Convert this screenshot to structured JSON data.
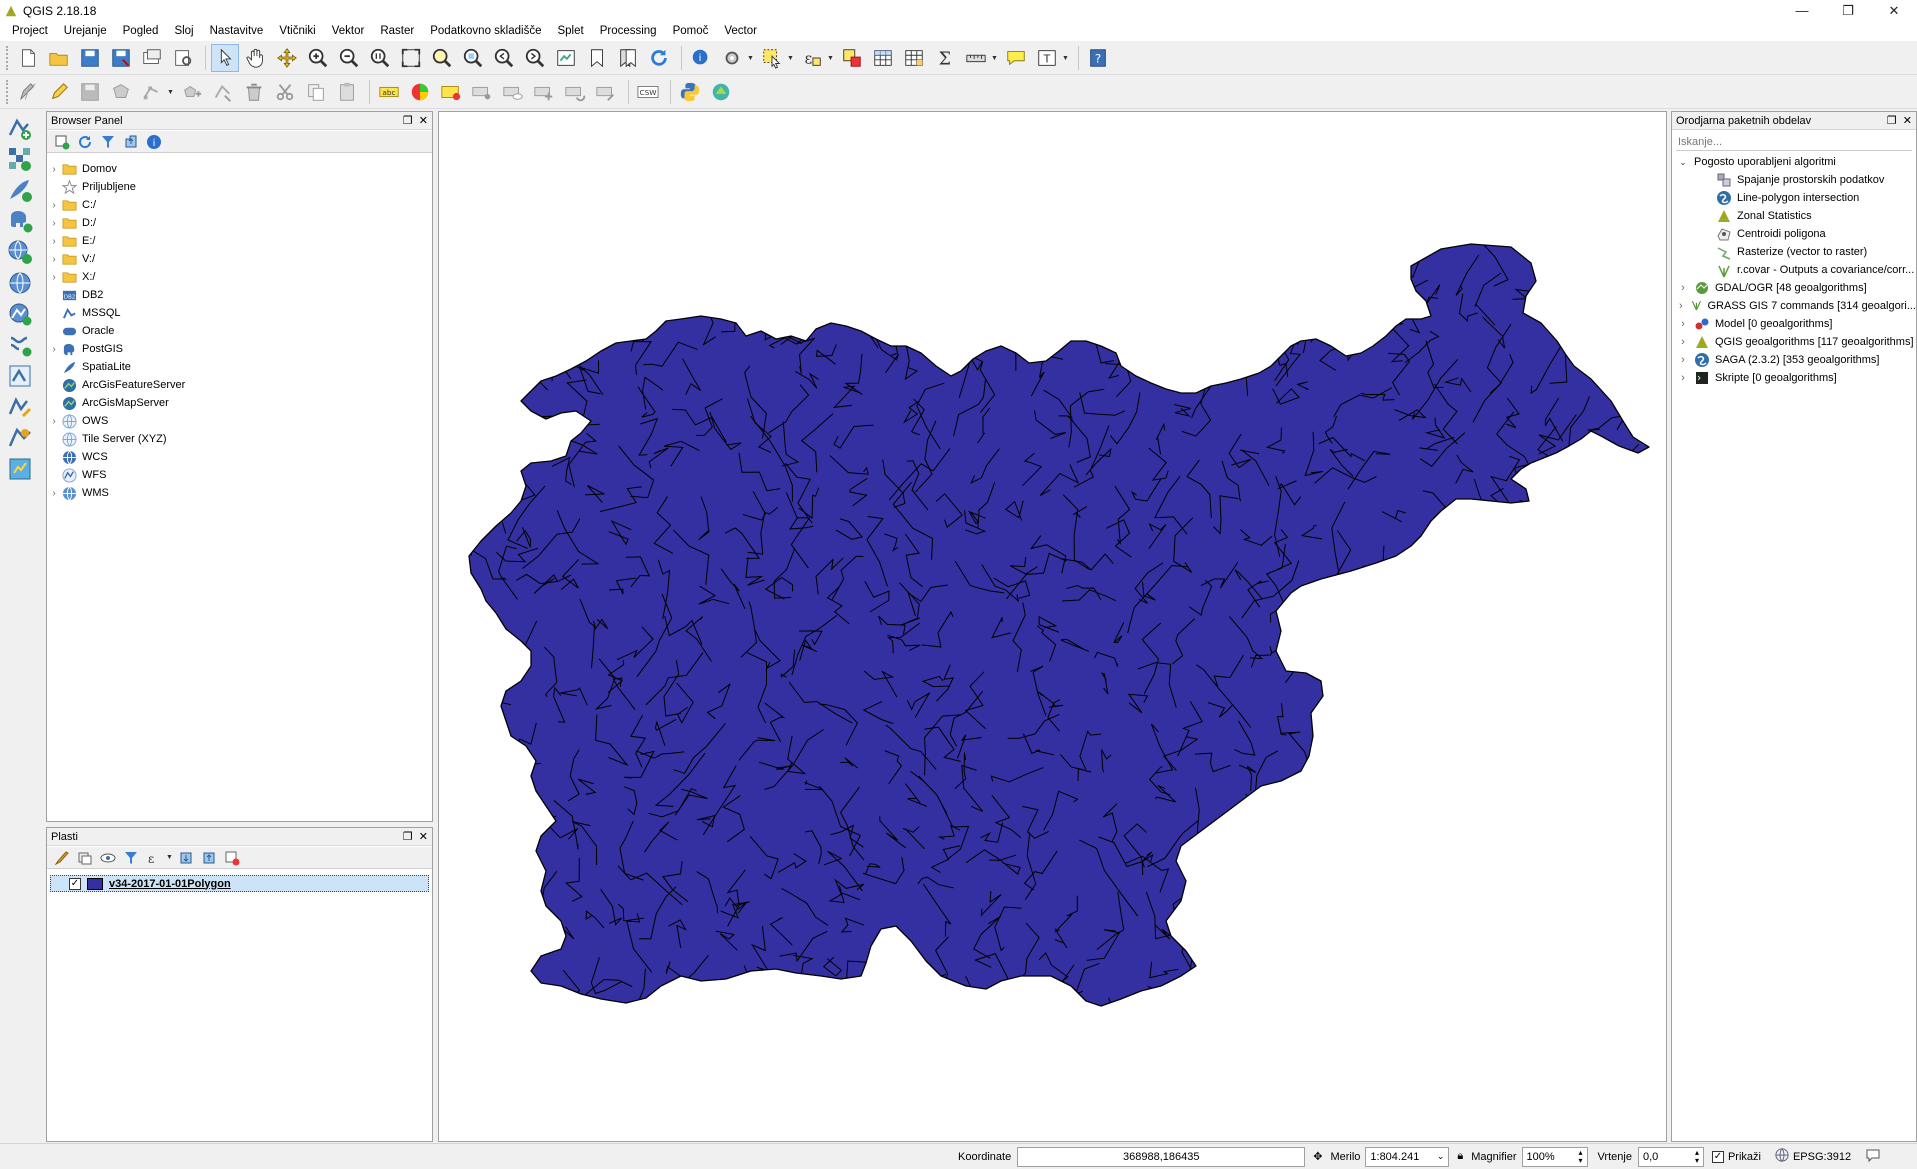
{
  "window": {
    "title": "QGIS 2.18.18",
    "minimize": "—",
    "maximize": "❐",
    "close": "✕"
  },
  "menu": [
    "Project",
    "Urejanje",
    "Pogled",
    "Sloj",
    "Nastavitve",
    "Vtičniki",
    "Vektor",
    "Raster",
    "Podatkovno skladišče",
    "Splet",
    "Processing",
    "Pomoč",
    "Vector"
  ],
  "toolbar": {
    "csw_label": "CSW",
    "abc_label": "abc"
  },
  "browser_panel": {
    "title": "Browser Panel",
    "items": [
      {
        "label": "Domov",
        "icon": "folder-icon",
        "expandable": true
      },
      {
        "label": "Priljubljene",
        "icon": "star-icon",
        "expandable": false
      },
      {
        "label": "C:/",
        "icon": "folder-icon",
        "expandable": true
      },
      {
        "label": "D:/",
        "icon": "folder-icon",
        "expandable": true
      },
      {
        "label": "E:/",
        "icon": "folder-icon",
        "expandable": true
      },
      {
        "label": "V:/",
        "icon": "folder-icon",
        "expandable": true
      },
      {
        "label": "X:/",
        "icon": "folder-icon",
        "expandable": true
      },
      {
        "label": "DB2",
        "icon": "db2-icon",
        "expandable": false
      },
      {
        "label": "MSSQL",
        "icon": "mssql-icon",
        "expandable": false
      },
      {
        "label": "Oracle",
        "icon": "oracle-icon",
        "expandable": false
      },
      {
        "label": "PostGIS",
        "icon": "postgis-icon",
        "expandable": true
      },
      {
        "label": "SpatiaLite",
        "icon": "spatialite-icon",
        "expandable": false
      },
      {
        "label": "ArcGisFeatureServer",
        "icon": "arcgis-icon",
        "expandable": false
      },
      {
        "label": "ArcGisMapServer",
        "icon": "arcgis-icon",
        "expandable": false
      },
      {
        "label": "OWS",
        "icon": "globe-icon",
        "expandable": true
      },
      {
        "label": "Tile Server (XYZ)",
        "icon": "globe-icon",
        "expandable": false
      },
      {
        "label": "WCS",
        "icon": "globe-icon",
        "expandable": false
      },
      {
        "label": "WFS",
        "icon": "globe-icon",
        "expandable": false
      },
      {
        "label": "WMS",
        "icon": "globe-icon",
        "expandable": true
      }
    ]
  },
  "layers_panel": {
    "title": "Plasti",
    "layers": [
      {
        "name": "v34-2017-01-01Polygon",
        "checked": true,
        "color": "#3530a2"
      }
    ]
  },
  "processing_panel": {
    "title": "Orodjarna paketnih obdelav",
    "search_placeholder": "Iskanje...",
    "group_title": "Pogosto uporabljeni algoritmi",
    "recent": [
      {
        "label": "Spajanje prostorskih podatkov",
        "icon": "merge-icon"
      },
      {
        "label": "Line-polygon intersection",
        "icon": "saga-icon"
      },
      {
        "label": "Zonal Statistics",
        "icon": "qgis-algorithm-icon"
      },
      {
        "label": "Centroidi poligona",
        "icon": "centroid-icon"
      },
      {
        "label": "Rasterize (vector to raster)",
        "icon": "rasterize-icon"
      },
      {
        "label": "r.covar - Outputs a covariance/corr...",
        "icon": "grass-icon"
      }
    ],
    "providers": [
      {
        "label": "GDAL/OGR [48 geoalgorithms]",
        "icon": "gdal-icon"
      },
      {
        "label": "GRASS GIS 7 commands [314 geoalgori...",
        "icon": "grass-icon"
      },
      {
        "label": "Model [0 geoalgorithms]",
        "icon": "model-icon"
      },
      {
        "label": "QGIS geoalgorithms [117 geoalgorithms]",
        "icon": "qgis-algorithm-icon"
      },
      {
        "label": "SAGA (2.3.2) [353 geoalgorithms]",
        "icon": "saga-icon"
      },
      {
        "label": "Skripte [0 geoalgorithms]",
        "icon": "script-icon"
      }
    ]
  },
  "statusbar": {
    "coord_label": "Koordinate",
    "coord_value": "368988,186435",
    "scale_label": "Merilo",
    "scale_value": "1:804.241",
    "magnifier_label": "Magnifier",
    "magnifier_value": "100%",
    "rotation_label": "Vrtenje",
    "rotation_value": "0,0",
    "render_label": "Prikaži",
    "crs_label": "EPSG:3912"
  },
  "colors": {
    "polygon_fill": "#3530a2",
    "polygon_stroke": "#000000",
    "accent": "#cde3f7"
  }
}
